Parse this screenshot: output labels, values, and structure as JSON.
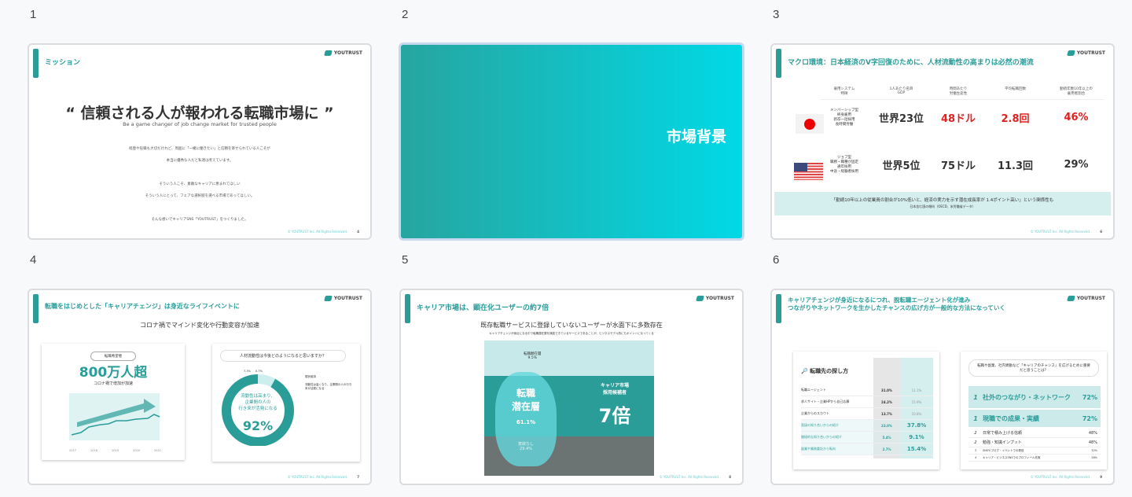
{
  "slides": [
    {
      "number": "1",
      "title": "ミッション",
      "logo": "YOUTRUST",
      "headline": "“ 信頼される人が報われる転職市場に ”",
      "subtitle": "Be a game changer of job change market for trusted people",
      "body": [
        "経歴や役職も大切だけれど、周囲に「一緒に働きたい」と信頼を寄せられている人こそが",
        "本当に優秀な人だと私達は考えています。",
        "そういう人こそ、素敵なキャリアに恵まれてほしい",
        "そういう人にとって、フェアな選択肢を選べる市場であってほしい。",
        "そんな想いでキャリアSNS「YOUTRUST」をつくりました。"
      ],
      "copyright": "© YOUTRUST Inc. All Rights Reserved.",
      "page": "4"
    },
    {
      "number": "2",
      "title": "市場背景"
    },
    {
      "number": "3",
      "title": "マクロ環境：日本経済のV字回復のために、人材流動性の高まりは必然の潮流",
      "logo": "YOUTRUST",
      "headers": [
        "雇用システム\n特徴",
        "1人あたり名目\nGDP",
        "時間あたり\n労働生産性",
        "平均転職回数",
        "勤続年数10年以上の\n雇用者割合"
      ],
      "rows": [
        {
          "flag": "japan-flag",
          "system": "メンバーシップ型\n終身雇用\n新卒一括採用\n長時間労働",
          "gdp": "世界23位",
          "prod": "48ドル",
          "moves": "2.8回",
          "tenure": "46%"
        },
        {
          "flag": "usa-flag",
          "system": "ジョブ型\n職務・職種が固定\n通年採用\n中途・経験者採用",
          "gdp": "世界5位",
          "prod": "75ドル",
          "moves": "11.3回",
          "tenure": "29%"
        }
      ],
      "banner": "「勤続10年以上の従業員の割合が10%低いと、経済の実力を示す潜在成長率が 1.4ポイント高い」という関係性も",
      "banner_sub": "日本含む国の傾向（OECD、米労働省データ）",
      "copyright": "© YOUTRUST Inc. All Rights Reserved.",
      "page": "6"
    },
    {
      "number": "4",
      "title": "転職をはじめとした「キャリアチェンジ」は身近なライフイベントに",
      "logo": "YOUTRUST",
      "heading": "コロナ禍でマインド変化や行動変容が加速",
      "left_badge": "転職希望者",
      "left_big": "800万人超",
      "left_sub": "コロナ禍で增加が加速",
      "years": [
        "2017",
        "2018",
        "2019",
        "2020",
        "2021"
      ],
      "question": "人材流動性は今後どのようになると思いますか？",
      "donut_center": "流動性は高まり、\n企業間の人の\n行き来が活発になる",
      "donut_value": "92%",
      "donut_fraction": 0.92,
      "small_slices": [
        "7.3%",
        "0.7%"
      ],
      "legend": [
        "現状維持",
        "流動性は高くなり、企業間の人の行き来が活発になる"
      ],
      "copyright": "© YOUTRUST Inc. All Rights Reserved.",
      "page": "7"
    },
    {
      "number": "5",
      "title": "キャリア市場は、顕在化ユーザーの約7倍",
      "logo": "YOUTRUST",
      "heading": "既存転職サービスに登録していないユーザーが水面下に多数存在",
      "sub": "キャリアチェンジが身近になる中で転職潜在層を捕捉できているサービスであることが、ビジネスモデル的にもポイントになってくる",
      "top_label": "転職顕在層",
      "top_value": "9.5%",
      "mid_label": "転職\n潜在層",
      "mid_value": "61.1%",
      "bottom_label": "意欲なし",
      "bottom_value": "29.4%",
      "right_label": "キャリア市場\n採用候補者",
      "right_big": "7倍",
      "copyright": "© YOUTRUST Inc. All Rights Reserved.",
      "page": "8"
    },
    {
      "number": "6",
      "title": "キャリアチェンジが身近になるにつれ、脱転職エージェント化が進み\nつながりやネットワークを生かしたチャンスの広げ方が一般的な方法になっていく",
      "logo": "YOUTRUST",
      "table_title": "転職先の探し方",
      "methods": [
        {
          "label": "転職エージェント",
          "a": "31.0%",
          "b": "11.1%"
        },
        {
          "label": "求人サイト・企業HPから自己応募",
          "a": "24.2%",
          "b": "15.9%"
        },
        {
          "label": "企業からのスカウト",
          "a": "13.7%",
          "b": "10.8%"
        },
        {
          "label": "直接の知り合いからの紹介",
          "a": "23.0%",
          "b": "37.8%"
        },
        {
          "label": "間接的な知り合いからの紹介",
          "a": "5.4%",
          "b": "9.1%"
        },
        {
          "label": "副業や業務委託から転向",
          "a": "2.7%",
          "b": "15.4%"
        }
      ],
      "ranking_q": "転職や副業、社内異動など「キャリアのチャンス」を広げるために重要だと思うことは？",
      "ranking": [
        {
          "rank": "1",
          "label": "社外のつながり・ネットワーク",
          "value": "72%"
        },
        {
          "rank": "1",
          "label": "現職での成果・実績",
          "value": "72%"
        },
        {
          "rank": "2",
          "label": "日常で積み上げる信頼",
          "value": "48%"
        },
        {
          "rank": "2",
          "label": "勉強・知識インプット",
          "value": "48%"
        },
        {
          "rank": "3",
          "label": "SNSやブログ・イベントでの発信",
          "value": "32%"
        },
        {
          "rank": "4",
          "label": "キャリア・ビジネスSNSでのプロフィール充実",
          "value": "28%"
        }
      ],
      "copyright": "© YOUTRUST Inc. All Rights Reserved.",
      "page": "9"
    }
  ],
  "colors": {
    "accent": "#2a9d99",
    "red": "#e12020"
  }
}
